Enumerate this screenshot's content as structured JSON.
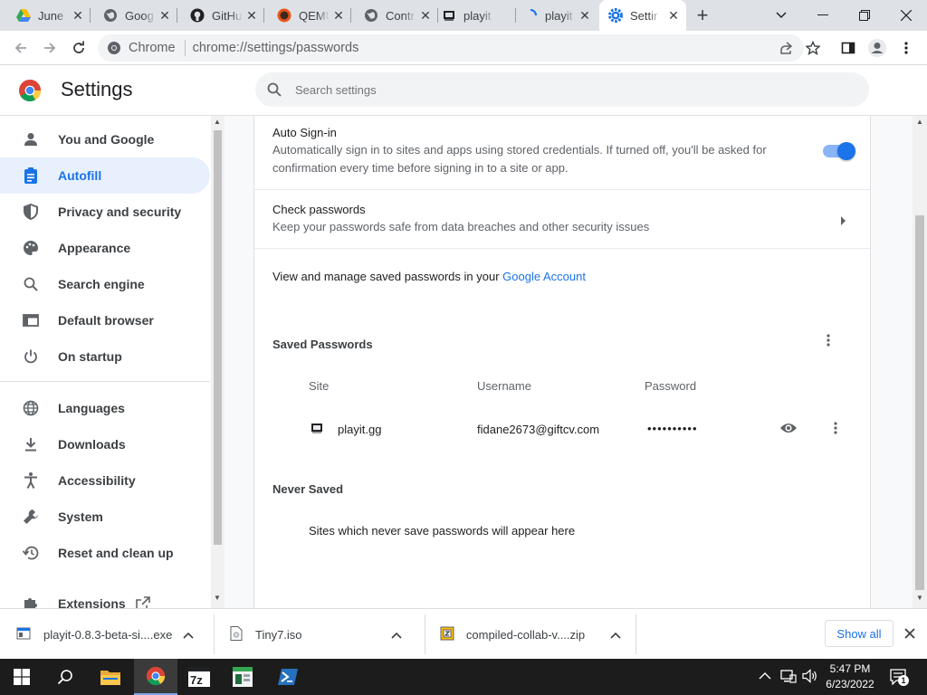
{
  "tabs": [
    {
      "title": "June",
      "icon": "google-drive-icon"
    },
    {
      "title": "Goog",
      "icon": "globe-icon"
    },
    {
      "title": "GitHu",
      "icon": "github-icon"
    },
    {
      "title": "QEMU",
      "icon": "qemu-icon"
    },
    {
      "title": "Contr",
      "icon": "globe-icon"
    },
    {
      "title": "playit",
      "icon": "playit-icon"
    },
    {
      "title": "playit",
      "icon": "loading-icon"
    },
    {
      "title": "Settir",
      "icon": "settings-gear-icon"
    }
  ],
  "window_controls": {
    "minimize": "–",
    "restore": "❐",
    "close": "✕",
    "tab_search": "⌄",
    "new_tab": "+"
  },
  "omnibox": {
    "scheme_label": "Chrome",
    "url_host": "chrome://",
    "url_path": "settings/passwords"
  },
  "header": {
    "title": "Settings",
    "search_placeholder": "Search settings"
  },
  "sidebar": {
    "items": [
      {
        "label": "You and Google",
        "icon": "person-icon"
      },
      {
        "label": "Autofill",
        "icon": "clipboard-icon",
        "selected": true
      },
      {
        "label": "Privacy and security",
        "icon": "shield-icon"
      },
      {
        "label": "Appearance",
        "icon": "palette-icon"
      },
      {
        "label": "Search engine",
        "icon": "search-icon"
      },
      {
        "label": "Default browser",
        "icon": "browser-icon"
      },
      {
        "label": "On startup",
        "icon": "power-icon"
      },
      {
        "label": "Languages",
        "icon": "globe-icon"
      },
      {
        "label": "Downloads",
        "icon": "download-icon"
      },
      {
        "label": "Accessibility",
        "icon": "accessibility-icon"
      },
      {
        "label": "System",
        "icon": "wrench-icon"
      },
      {
        "label": "Reset and clean up",
        "icon": "restore-icon"
      },
      {
        "label": "Extensions",
        "icon": "puzzle-icon"
      }
    ]
  },
  "passwords": {
    "auto_signin_title": "Auto Sign-in",
    "auto_signin_desc": "Automatically sign in to sites and apps using stored credentials. If turned off, you'll be asked for confirmation every time before signing in to a site or app.",
    "auto_signin_enabled": true,
    "check_title": "Check passwords",
    "check_desc": "Keep your passwords safe from data breaches and other security issues",
    "manage_text": "View and manage saved passwords in your ",
    "manage_link": "Google Account",
    "saved_heading": "Saved Passwords",
    "columns": {
      "site": "Site",
      "username": "Username",
      "password": "Password"
    },
    "entries": [
      {
        "site": "playit.gg",
        "username": "fidane2673@giftcv.com",
        "password": "••••••••••"
      }
    ],
    "never_heading": "Never Saved",
    "never_empty": "Sites which never save passwords will appear here"
  },
  "downloads": {
    "items": [
      {
        "name": "playit-0.8.3-beta-si....exe",
        "icon": "installer-file-icon"
      },
      {
        "name": "Tiny7.iso",
        "icon": "disc-file-icon"
      },
      {
        "name": "compiled-collab-v....zip",
        "icon": "zip-file-icon"
      }
    ],
    "show_all": "Show all"
  },
  "taskbar": {
    "apps": [
      "windows-start-icon",
      "search-icon",
      "file-explorer-icon",
      "chrome-icon",
      "7zip-icon",
      "notepad-app-icon",
      "powershell-icon"
    ],
    "time": "5:47 PM",
    "date": "6/23/2022",
    "notification_count": "1"
  },
  "colors": {
    "accent": "#1a73e8",
    "selected_bg": "#e8f0fe",
    "text": "#202124",
    "muted": "#5f6368"
  }
}
